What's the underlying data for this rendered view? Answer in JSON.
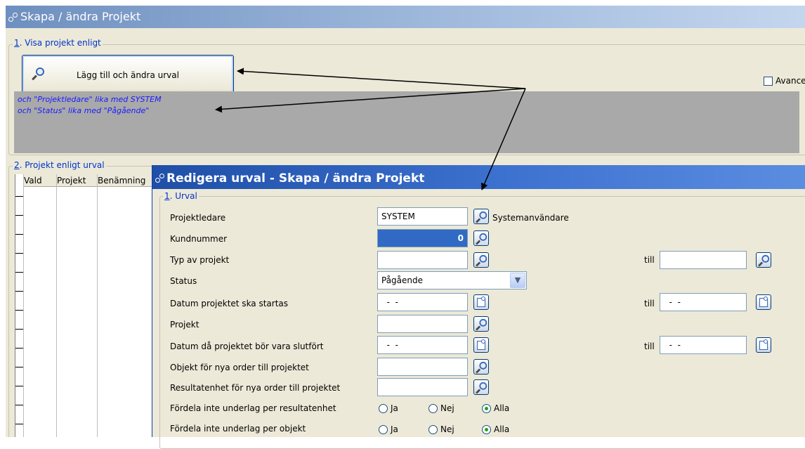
{
  "main_window": {
    "title": "Skapa / ändra Projekt",
    "section1_legend_num": "1",
    "section1_legend_text": ". Visa projekt enligt",
    "add_change_button": "Lägg till och ändra urval",
    "criteria_lines": [
      "och \"Projektledare\" lika med SYSTEM",
      "och \"Status\" lika med \"Pågående\""
    ],
    "advanced_checkbox_label": "Avancera",
    "section2_legend_num": "2",
    "section2_legend_text": ". Projekt enligt urval",
    "grid_columns": [
      "Vald",
      "Projekt",
      "Benämning"
    ]
  },
  "dialog": {
    "title": "Redigera urval - Skapa / ändra Projekt",
    "section_legend_num": "1",
    "section_legend_text": ". Urval",
    "till_label": "till",
    "rows": {
      "projektledare": {
        "label": "Projektledare",
        "value": "SYSTEM",
        "description": "Systemanvändare"
      },
      "kundnummer": {
        "label": "Kundnummer",
        "value": "0"
      },
      "typ": {
        "label": "Typ av projekt",
        "value": "",
        "to_value": ""
      },
      "status": {
        "label": "Status",
        "value": "Pågående"
      },
      "datum_start": {
        "label": "Datum projektet ska startas",
        "value": "  -  -",
        "to_value": "  -  -"
      },
      "projekt": {
        "label": "Projekt",
        "value": ""
      },
      "datum_slut": {
        "label": "Datum då projektet bör vara slutfört",
        "value": "  -  -",
        "to_value": "  -  -"
      },
      "objekt": {
        "label": "Objekt  för nya order till projektet",
        "value": ""
      },
      "resultatenhet": {
        "label": "Resultatenhet för nya order till projektet",
        "value": ""
      },
      "fordela_resultatenhet": {
        "label": "Fördela inte underlag per resultatenhet",
        "selected": "Alla"
      },
      "fordela_objekt": {
        "label": "Fördela inte underlag per objekt",
        "selected": "Alla"
      }
    },
    "radio_options": {
      "ja": "Ja",
      "nej": "Nej",
      "alla": "Alla"
    }
  }
}
